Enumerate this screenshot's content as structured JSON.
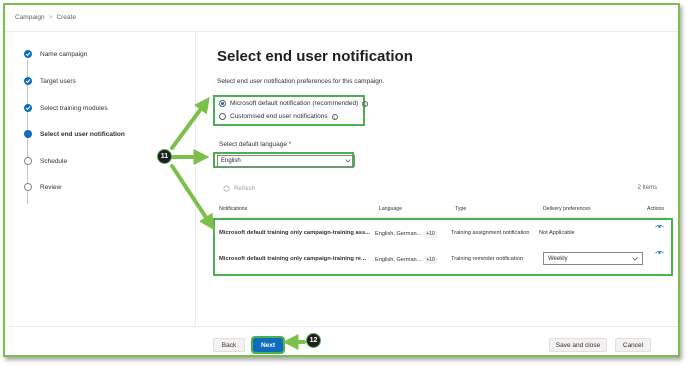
{
  "breadcrumb": {
    "root": "Campaign",
    "separator": ">",
    "current": "Create"
  },
  "steps": [
    {
      "label": "Name campaign",
      "state": "done"
    },
    {
      "label": "Target users",
      "state": "done"
    },
    {
      "label": "Select training modules",
      "state": "done"
    },
    {
      "label": "Select end user notification",
      "state": "current"
    },
    {
      "label": "Schedule",
      "state": "todo"
    },
    {
      "label": "Review",
      "state": "todo"
    }
  ],
  "page": {
    "title": "Select end user notification",
    "subtitle": "Select end user notification preferences for this campaign."
  },
  "notification_options": [
    {
      "label": "Microsoft default notification (recommended)",
      "selected": true
    },
    {
      "label": "Customised end user notifications",
      "selected": false
    }
  ],
  "language": {
    "label": "Select default language",
    "required_mark": "*",
    "value": "English"
  },
  "toolbar": {
    "refresh_label": "Refresh",
    "count": "2 items"
  },
  "table": {
    "columns": [
      "Notifications",
      "Language",
      "Type",
      "Delivery preferences",
      "Actions"
    ],
    "rows": [
      {
        "notification": "Microsoft default training only campaign-training ass...",
        "language": "English, German...",
        "language_more": "+10",
        "type": "Training assignment notification",
        "delivery": "Not Applicable"
      },
      {
        "notification": "Microsoft default training only campaign-training re...",
        "language": "English, German...",
        "language_more": "+10",
        "type": "Training reminder notification",
        "delivery": "Weekly"
      }
    ]
  },
  "footer": {
    "back": "Back",
    "next": "Next",
    "save_close": "Save and close",
    "cancel": "Cancel"
  },
  "callouts": {
    "first": "11",
    "second": "12"
  },
  "colors": {
    "accent": "#0f6cbd",
    "highlight": "#4caf50",
    "frame": "#7cc04b"
  },
  "icons": [
    "check-icon",
    "info-icon",
    "chevron-down-icon",
    "refresh-icon",
    "eye-icon"
  ]
}
